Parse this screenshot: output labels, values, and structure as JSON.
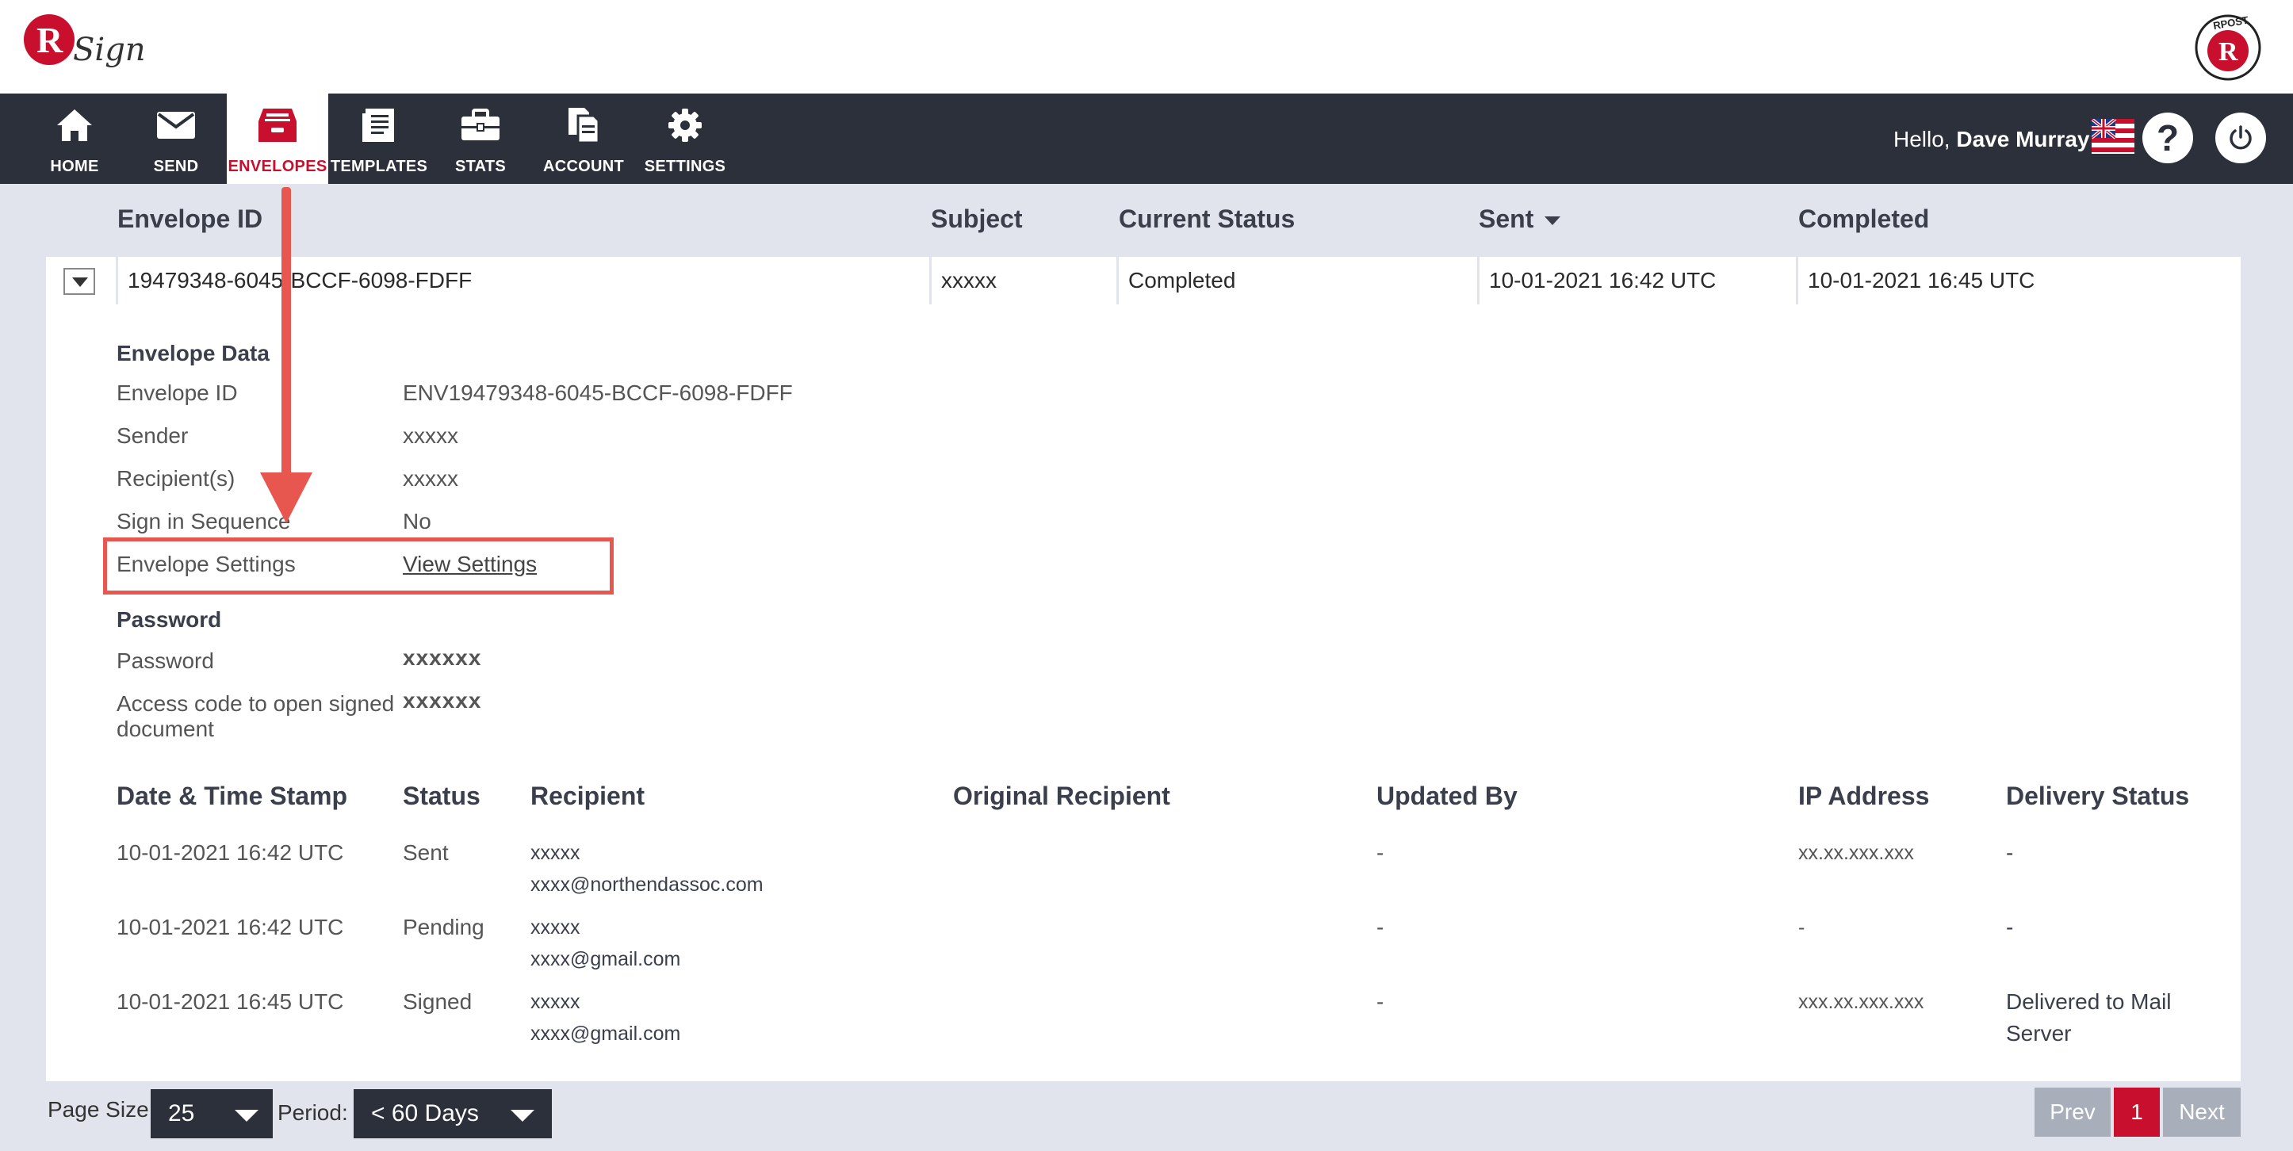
{
  "brand": {
    "logo_text": "RSign",
    "rpost_text": "RPOST",
    "accent": "#c8102e",
    "nav_bg": "#2b303b"
  },
  "nav": {
    "items": [
      {
        "label": "HOME",
        "icon": "home-icon"
      },
      {
        "label": "SEND",
        "icon": "envelope-icon"
      },
      {
        "label": "ENVELOPES",
        "icon": "inbox-icon",
        "active": true
      },
      {
        "label": "TEMPLATES",
        "icon": "document-icon"
      },
      {
        "label": "STATS",
        "icon": "briefcase-icon"
      },
      {
        "label": "ACCOUNT",
        "icon": "files-icon"
      },
      {
        "label": "SETTINGS",
        "icon": "gear-icon"
      }
    ]
  },
  "user": {
    "greeting": "Hello,",
    "name": "Dave Murray",
    "help_label": "?"
  },
  "list": {
    "headers": {
      "envelope_id": "Envelope ID",
      "subject": "Subject",
      "current_status": "Current Status",
      "sent": "Sent",
      "completed": "Completed"
    },
    "row": {
      "envelope_id": "19479348-6045-BCCF-6098-FDFF",
      "subject": "xxxxx",
      "current_status": "Completed",
      "sent": "10-01-2021 16:42 UTC",
      "completed": "10-01-2021 16:45 UTC"
    }
  },
  "details": {
    "envelope_data_title": "Envelope Data",
    "fields": [
      {
        "label": "Envelope ID",
        "value": "ENV19479348-6045-BCCF-6098-FDFF"
      },
      {
        "label": "Sender",
        "value": "xxxxx"
      },
      {
        "label": "Recipient(s)",
        "value": "xxxxx"
      },
      {
        "label": "Sign in Sequence",
        "value": "No"
      },
      {
        "label": "Envelope Settings",
        "value": "View Settings"
      }
    ],
    "password_title": "Password",
    "password_fields": [
      {
        "label": "Password",
        "value": "xxxxxx"
      },
      {
        "label_line1": "Access code to open signed",
        "label_line2": "document",
        "value": "xxxxxx"
      }
    ]
  },
  "history": {
    "headers": {
      "date": "Date & Time Stamp",
      "status": "Status",
      "recipient": "Recipient",
      "original_recipient": "Original Recipient",
      "updated_by": "Updated By",
      "ip_address": "IP Address",
      "delivery_status": "Delivery Status"
    },
    "rows": [
      {
        "date": "10-01-2021 16:42 UTC",
        "status": "Sent",
        "recipient_name": "xxxxx",
        "recipient_email": "xxxx@northendassoc.com",
        "original_recipient": "",
        "updated_by": "-",
        "ip": "xx.xx.xxx.xxx",
        "delivery_line1": "-",
        "delivery_line2": ""
      },
      {
        "date": "10-01-2021 16:42 UTC",
        "status": "Pending",
        "recipient_name": "xxxxx",
        "recipient_email": "xxxx@gmail.com",
        "original_recipient": "",
        "updated_by": "-",
        "ip": "-",
        "delivery_line1": "-",
        "delivery_line2": ""
      },
      {
        "date": "10-01-2021 16:45 UTC",
        "status": "Signed",
        "recipient_name": "xxxxx",
        "recipient_email": "xxxx@gmail.com",
        "original_recipient": "",
        "updated_by": "-",
        "ip": "xxx.xx.xxx.xxx",
        "delivery_line1": "Delivered to Mail",
        "delivery_line2": "Server"
      }
    ]
  },
  "footer": {
    "page_size_label": "Page Size:",
    "page_size_value": "25",
    "period_label": "Period:",
    "period_value": "< 60 Days",
    "prev": "Prev",
    "current_page": "1",
    "next": "Next"
  },
  "annotation": {
    "color": "#e8574f"
  }
}
